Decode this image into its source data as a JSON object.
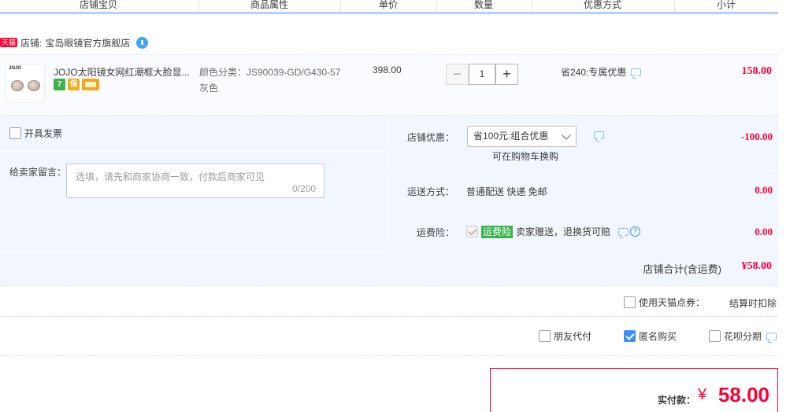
{
  "header": {
    "columns": [
      "店铺宝贝",
      "商品属性",
      "单价",
      "数量",
      "优惠方式",
      "小计"
    ]
  },
  "shop": {
    "badge": "天猫",
    "label": "店铺:",
    "name": "宝岛眼镜官方旗舰店"
  },
  "item": {
    "brand": "JOJO",
    "title": "JOJO太阳镜女网红潮框大脸显...",
    "badges": [
      "7",
      "保",
      "卡"
    ],
    "attr": "颜色分类：JS90039-GD/G430-57灰色",
    "price": "398.00",
    "quantity": "1",
    "promo": "省240:专属优惠",
    "subtotal": "158.00"
  },
  "invoice": {
    "label": "开具发票",
    "checked": false
  },
  "memo": {
    "label": "给卖家留言：",
    "placeholder": "选填，请先和商家协商一致，付款后商家可见",
    "counter": "0/200"
  },
  "coupon": {
    "label": "店铺优惠：",
    "selected": "省100元:组合优惠",
    "sub": "可在购物车换购",
    "amount": "-100.00"
  },
  "shipping": {
    "label": "运送方式：",
    "value": "普通配送 快递 免邮",
    "amount": "0.00"
  },
  "insurance": {
    "label": "运费险：",
    "tag": "运费险",
    "text": "卖家赠送，退换货可赔",
    "help": "?",
    "amount": "0.00"
  },
  "shop_total": {
    "label": "店铺合计(含运费)",
    "value": "¥58.00"
  },
  "points": {
    "label": "使用天猫点券：",
    "deduct": "结算时扣除"
  },
  "pay_options": [
    {
      "label": "朋友代付",
      "checked": false
    },
    {
      "label": "匿名购买",
      "checked": true
    },
    {
      "label": "花呗分期",
      "checked": false
    }
  ],
  "final": {
    "label": "实付款：",
    "currency": "¥",
    "amount": "58.00"
  },
  "colors": {
    "accent": "#ff0036",
    "blue": "#3e8ef7",
    "panel": "#f2f7ff"
  }
}
